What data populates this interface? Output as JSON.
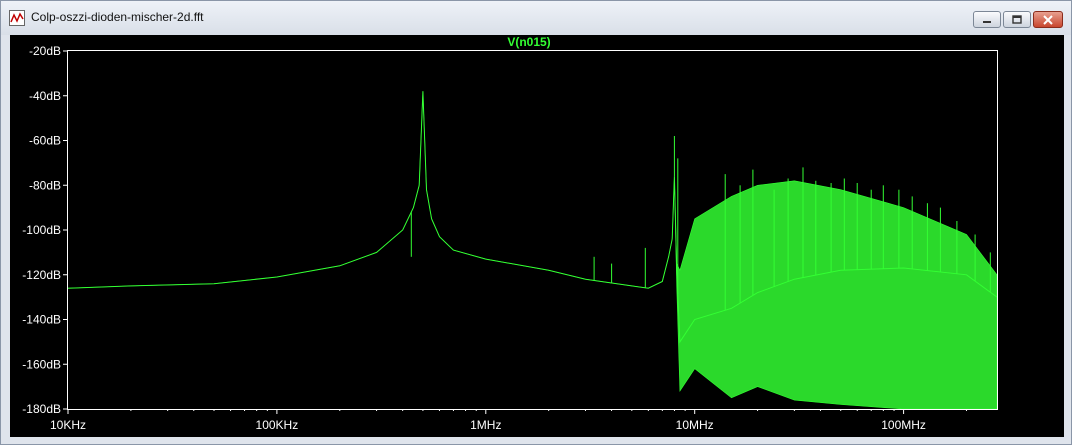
{
  "window": {
    "title": "Colp-oszzi-dioden-mischer-2d.fft",
    "title_icon": "waveform-icon",
    "buttons": {
      "minimize": "minimize-icon",
      "maximize": "maximize-icon",
      "close": "close-icon"
    }
  },
  "colors": {
    "background": "#000000",
    "trace": "#33ff33",
    "axis": "#ffffff",
    "trace_label": "#33ff33"
  },
  "chart_data": {
    "type": "line",
    "title": "V(n015)",
    "xlabel": "",
    "ylabel": "",
    "x_scale": "log",
    "xlim": [
      10000,
      280000000
    ],
    "ylim": [
      -180,
      -20
    ],
    "grid": false,
    "y_ticks": [
      "-20dB",
      "-40dB",
      "-60dB",
      "-80dB",
      "-100dB",
      "-120dB",
      "-140dB",
      "-160dB",
      "-180dB"
    ],
    "x_ticks": [
      "10KHz",
      "100KHz",
      "1MHz",
      "10MHz",
      "100MHz"
    ],
    "series": [
      {
        "name": "V(n015)",
        "x": [
          10000,
          20000,
          50000,
          100000,
          200000,
          300000,
          400000,
          450000,
          480000,
          500000,
          520000,
          550000,
          600000,
          700000,
          1000000,
          2000000,
          3000000,
          5000000,
          6000000,
          7000000,
          7500000,
          7800000,
          8000000,
          8200000,
          8500000,
          10000000,
          15000000,
          20000000,
          30000000,
          50000000,
          100000000,
          200000000,
          280000000
        ],
        "values": [
          -126,
          -125,
          -124,
          -121,
          -116,
          -110,
          -100,
          -90,
          -80,
          -38,
          -82,
          -95,
          -103,
          -109,
          -113,
          -118,
          -122,
          -125,
          -126,
          -123,
          -112,
          -104,
          -76,
          -118,
          -150,
          -140,
          -135,
          -128,
          -122,
          -118,
          -117,
          -120,
          -130
        ],
        "upper_envelope": [
          -126,
          -125,
          -124,
          -121,
          -116,
          -110,
          -100,
          -90,
          -80,
          -38,
          -82,
          -95,
          -103,
          -109,
          -113,
          -118,
          -122,
          -125,
          -126,
          -123,
          -112,
          -104,
          -76,
          -115,
          -118,
          -95,
          -85,
          -80,
          -78,
          -82,
          -90,
          -102,
          -120
        ],
        "lower_envelope": [
          -126,
          -125,
          -124,
          -121,
          -116,
          -110,
          -100,
          -90,
          -80,
          -38,
          -82,
          -95,
          -103,
          -109,
          -113,
          -118,
          -122,
          -125,
          -126,
          -123,
          -112,
          -104,
          -76,
          -125,
          -172,
          -162,
          -175,
          -170,
          -176,
          -178,
          -180,
          -180,
          -180
        ]
      }
    ],
    "spurs": [
      {
        "x": 440000,
        "y": -112
      },
      {
        "x": 3300000,
        "y": -112
      },
      {
        "x": 4000000,
        "y": -115
      },
      {
        "x": 5800000,
        "y": -108
      },
      {
        "x": 8000000,
        "y": -58
      },
      {
        "x": 8300000,
        "y": -68
      },
      {
        "x": 14000000,
        "y": -75
      },
      {
        "x": 16500000,
        "y": -80
      },
      {
        "x": 19000000,
        "y": -73
      },
      {
        "x": 24000000,
        "y": -82
      },
      {
        "x": 28000000,
        "y": -77
      },
      {
        "x": 33000000,
        "y": -72
      },
      {
        "x": 38000000,
        "y": -78
      },
      {
        "x": 45000000,
        "y": -79
      },
      {
        "x": 52000000,
        "y": -77
      },
      {
        "x": 60000000,
        "y": -79
      },
      {
        "x": 70000000,
        "y": -82
      },
      {
        "x": 80000000,
        "y": -80
      },
      {
        "x": 95000000,
        "y": -82
      },
      {
        "x": 110000000,
        "y": -85
      },
      {
        "x": 130000000,
        "y": -88
      },
      {
        "x": 150000000,
        "y": -90
      },
      {
        "x": 180000000,
        "y": -96
      },
      {
        "x": 220000000,
        "y": -102
      },
      {
        "x": 260000000,
        "y": -110
      }
    ]
  }
}
